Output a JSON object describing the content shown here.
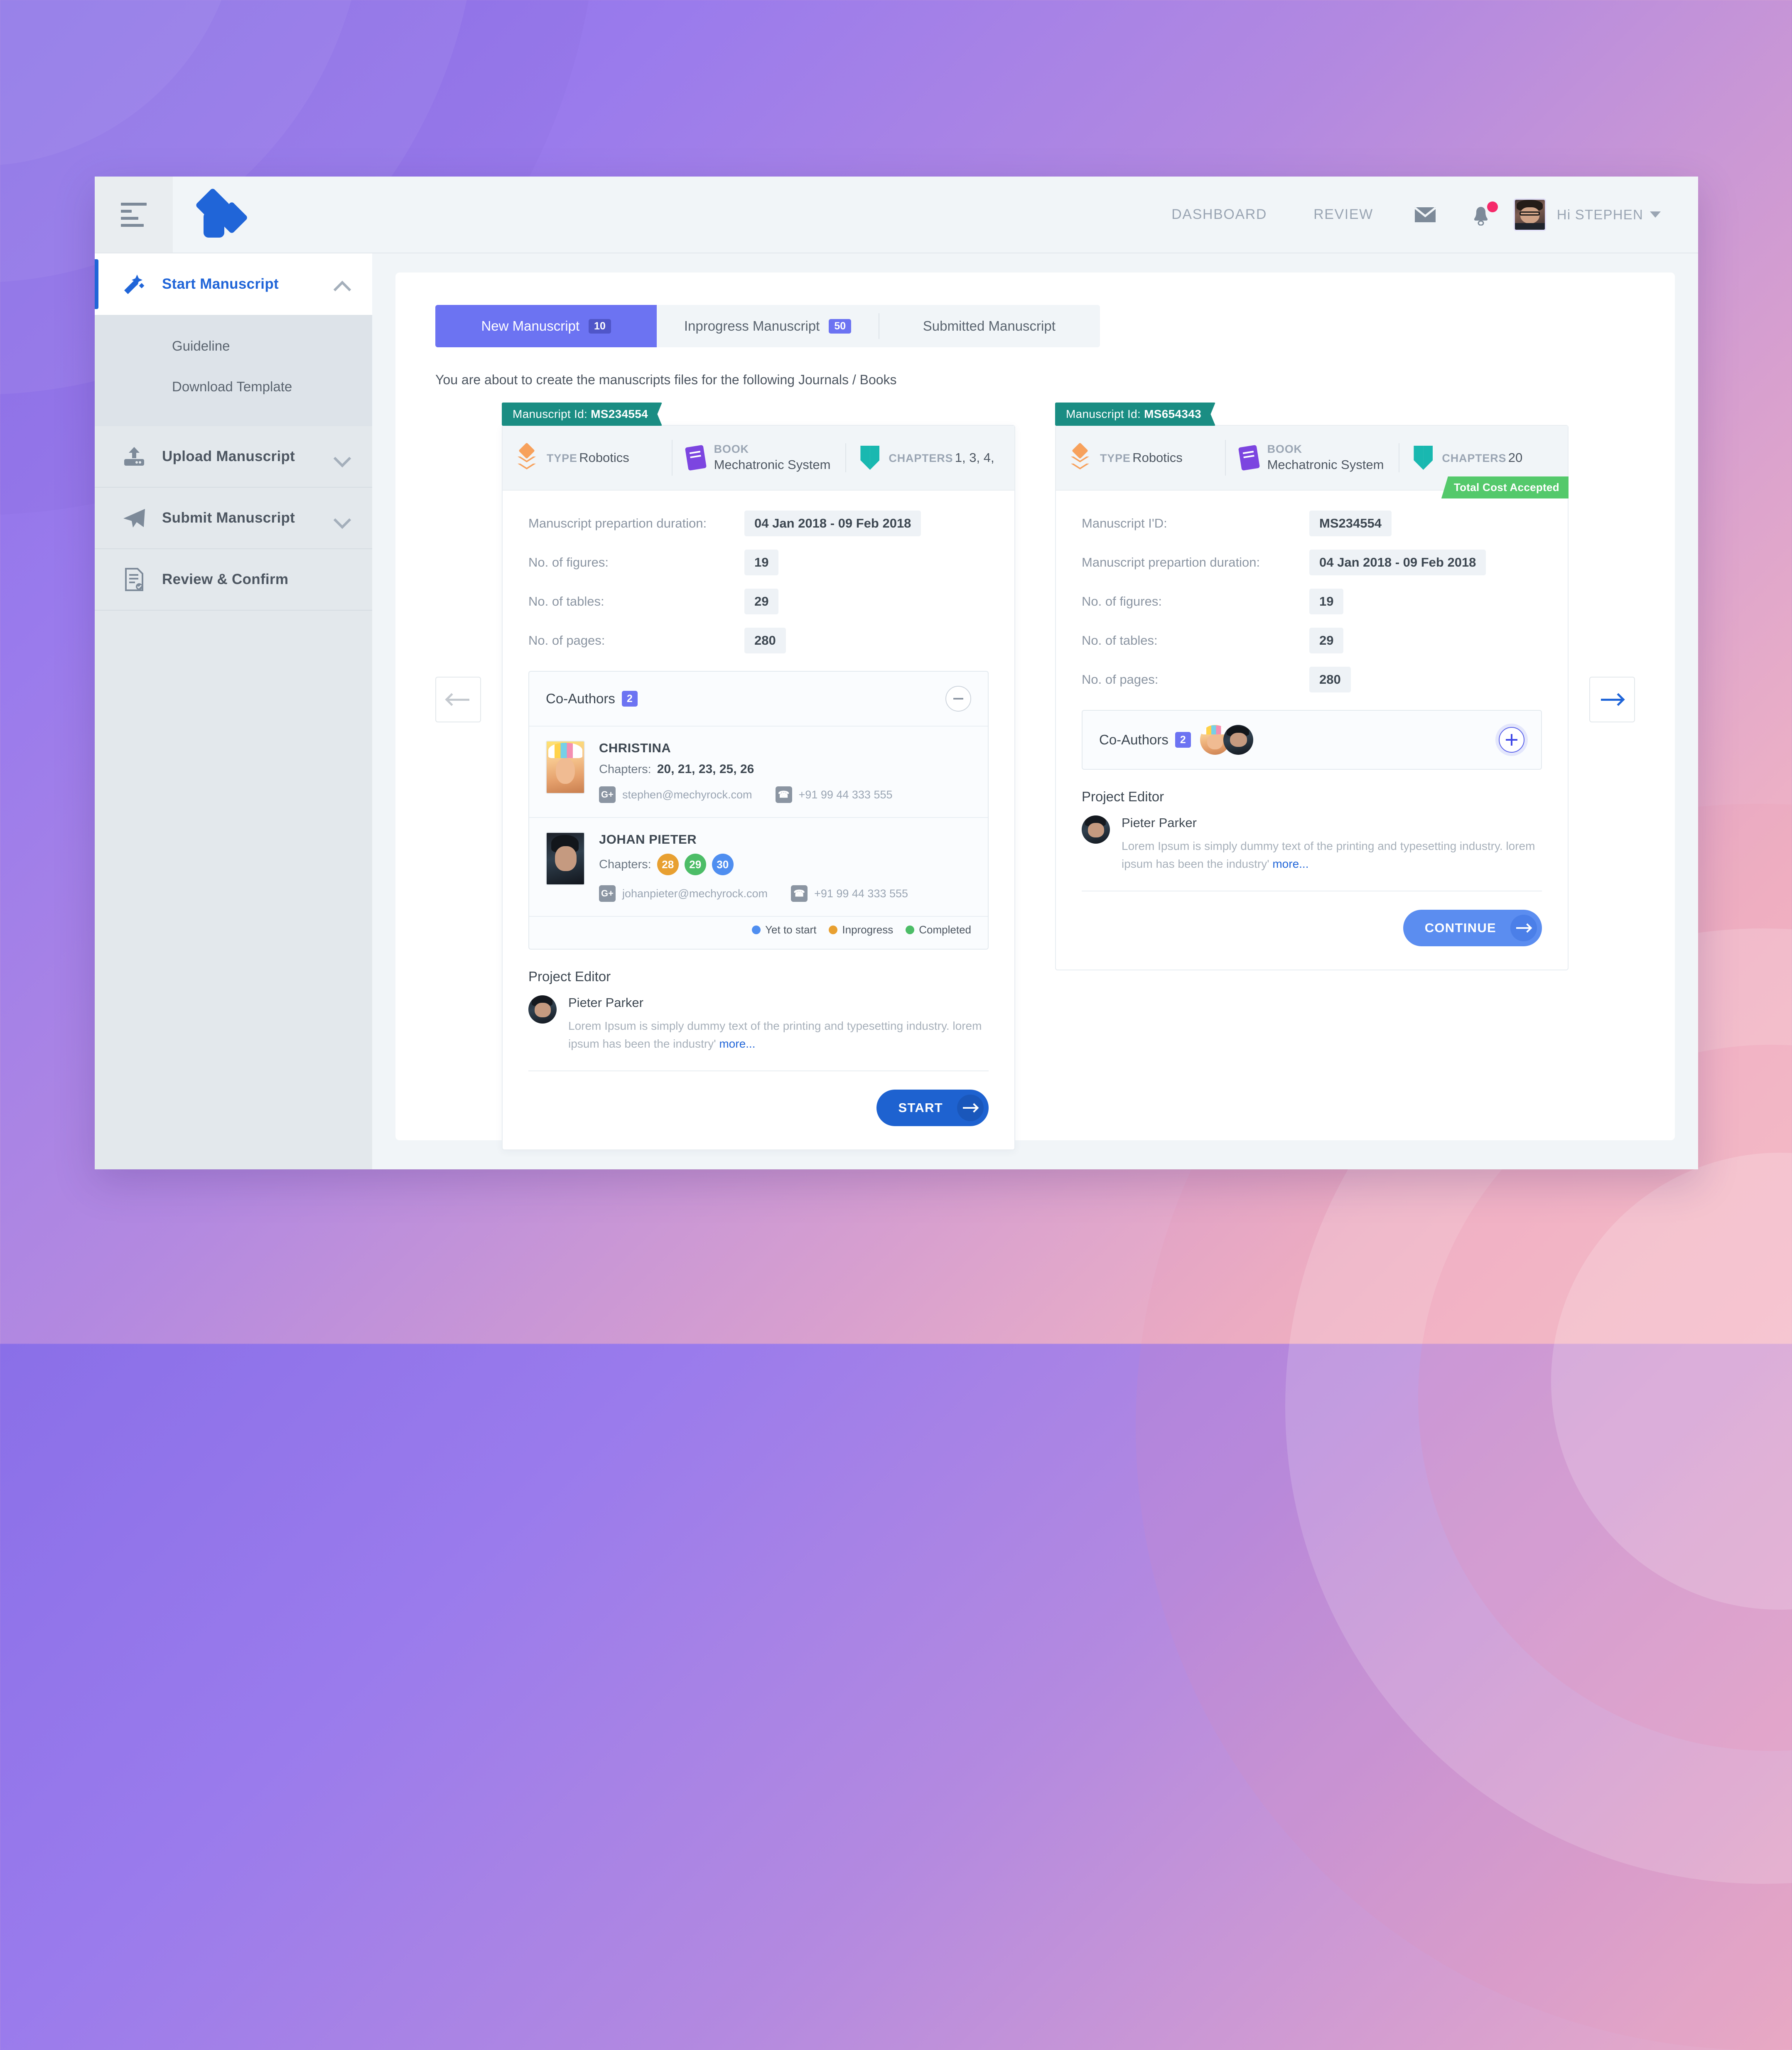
{
  "header": {
    "nav": [
      {
        "label": "DASHBOARD"
      },
      {
        "label": "REVIEW"
      }
    ],
    "mail_icon": "mail-icon",
    "notification_icon": "notification-bell-icon",
    "greeting": "Hi STEPHEN",
    "logo": "app-logo"
  },
  "sidebar": {
    "items": [
      {
        "label": "Start Manuscript",
        "icon": "magic-wand-icon",
        "active": true,
        "expanded": true,
        "children": [
          {
            "label": "Guideline"
          },
          {
            "label": "Download Template"
          }
        ]
      },
      {
        "label": "Upload Manuscript",
        "icon": "upload-icon",
        "active": false,
        "expanded": false
      },
      {
        "label": "Submit Manuscript",
        "icon": "paper-plane-icon",
        "active": false,
        "expanded": false
      },
      {
        "label": "Review & Confirm",
        "icon": "document-check-icon",
        "active": false,
        "expanded": false
      }
    ]
  },
  "tabs": [
    {
      "label": "New Manuscript",
      "count": "10",
      "active": true
    },
    {
      "label": "Inprogress Manuscript",
      "count": "50",
      "active": false
    },
    {
      "label": "Submitted Manuscript",
      "count": "",
      "active": false
    }
  ],
  "subtitle": "You are about to create the manuscripts files for the following Journals / Books",
  "carousel": {
    "prev_icon": "arrow-left-icon",
    "next_icon": "arrow-right-icon"
  },
  "colors": {
    "accent_blue": "#2065d8",
    "tab_purple": "#6c73f2",
    "tag_teal": "#1a8d83",
    "cost_green": "#54c96b",
    "type_orange": "#f7a15c",
    "book_purple": "#7c45e0",
    "chapters_teal": "#19b8b0",
    "notification_pink": "#f5296a"
  },
  "card_left": {
    "tag_prefix": "Manuscript Id: ",
    "tag_id": "MS234554",
    "head": [
      {
        "icon": "layers-icon",
        "label": "TYPE",
        "value": "Robotics"
      },
      {
        "icon": "book-icon",
        "label": "BOOK",
        "value": "Mechatronic System"
      },
      {
        "icon": "chapters-icon",
        "label": "CHAPTERS",
        "value": "1, 3, 4,"
      }
    ],
    "fields": [
      {
        "label": "Manuscript prepartion duration:",
        "value": "04 Jan 2018 - 09 Feb 2018"
      },
      {
        "label": "No. of figures:",
        "value": "19"
      },
      {
        "label": "No. of tables:",
        "value": "29"
      },
      {
        "label": "No. of pages:",
        "value": "280"
      }
    ],
    "coauthors": {
      "title": "Co-Authors",
      "count": "2",
      "toggle_icon": "minus-circle-icon",
      "authors": [
        {
          "name": "CHRISTINA",
          "chapters_label": "Chapters:",
          "chapters_text": "20, 21, 23, 25, 26",
          "chips": [],
          "email": "stephen@mechyrock.com",
          "phone": "+91 99 44 333 555",
          "email_icon": "google-plus-icon",
          "phone_icon": "phone-icon"
        },
        {
          "name": "JOHAN PIETER",
          "chapters_label": "Chapters:",
          "chapters_text": "",
          "chips": [
            {
              "num": "28",
              "status": "inprogress"
            },
            {
              "num": "29",
              "status": "completed"
            },
            {
              "num": "30",
              "status": "yet-to-start"
            }
          ],
          "email": "johanpieter@mechyrock.com",
          "phone": "+91 99 44 333 555",
          "email_icon": "google-plus-icon",
          "phone_icon": "phone-icon"
        }
      ],
      "legend": [
        {
          "label": "Yet to start",
          "color": "#4f8ef0"
        },
        {
          "label": "Inprogress",
          "color": "#e8a031"
        },
        {
          "label": "Completed",
          "color": "#4cbd67"
        }
      ]
    },
    "project_editor": {
      "title": "Project Editor",
      "name": "Pieter Parker",
      "description": "Lorem Ipsum is simply dummy text of the printing and typesetting industry. lorem ipsum has been the industry'",
      "more_label": "more..."
    },
    "action": {
      "label": "START",
      "icon": "arrow-right-icon"
    }
  },
  "card_right": {
    "tag_prefix": "Manuscript Id: ",
    "tag_id": "MS654343",
    "cost_badge": "Total Cost Accepted",
    "head": [
      {
        "icon": "layers-icon",
        "label": "TYPE",
        "value": "Robotics"
      },
      {
        "icon": "book-icon",
        "label": "BOOK",
        "value": "Mechatronic System"
      },
      {
        "icon": "chapters-icon",
        "label": "CHAPTERS",
        "value": "20"
      }
    ],
    "fields": [
      {
        "label": "Manuscript I'D:",
        "value": "MS234554"
      },
      {
        "label": "Manuscript prepartion duration:",
        "value": "04 Jan 2018 - 09 Feb 2018"
      },
      {
        "label": "No. of figures:",
        "value": "19"
      },
      {
        "label": "No. of tables:",
        "value": "29"
      },
      {
        "label": "No. of pages:",
        "value": "280"
      }
    ],
    "coauthors": {
      "title": "Co-Authors",
      "count": "2",
      "toggle_icon": "plus-circle-icon"
    },
    "project_editor": {
      "title": "Project Editor",
      "name": "Pieter Parker",
      "description": "Lorem Ipsum is simply dummy text of the printing and typesetting industry. lorem ipsum has been the industry'",
      "more_label": "more..."
    },
    "action": {
      "label": "CONTINUE",
      "icon": "arrow-right-icon"
    }
  }
}
